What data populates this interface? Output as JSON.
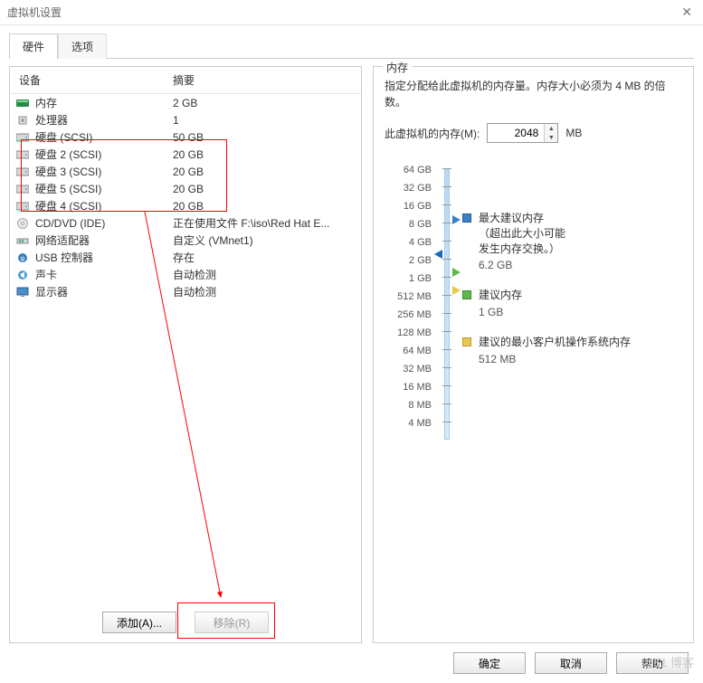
{
  "window_title": "虚拟机设置",
  "tabs": {
    "hardware": "硬件",
    "options": "选项"
  },
  "columns": {
    "device": "设备",
    "summary": "摘要"
  },
  "hardware": [
    {
      "icon": "memory-icon",
      "name": "内存",
      "summary": "2 GB"
    },
    {
      "icon": "cpu-icon",
      "name": "处理器",
      "summary": "1"
    },
    {
      "icon": "disk-icon",
      "name": "硬盘 (SCSI)",
      "summary": "50 GB"
    },
    {
      "icon": "disk-icon",
      "name": "硬盘 2 (SCSI)",
      "summary": "20 GB"
    },
    {
      "icon": "disk-icon",
      "name": "硬盘 3 (SCSI)",
      "summary": "20 GB"
    },
    {
      "icon": "disk-icon",
      "name": "硬盘 5 (SCSI)",
      "summary": "20 GB"
    },
    {
      "icon": "disk-icon",
      "name": "硬盘 4 (SCSI)",
      "summary": "20 GB"
    },
    {
      "icon": "cd-icon",
      "name": "CD/DVD (IDE)",
      "summary": "正在使用文件 F:\\iso\\Red Hat E..."
    },
    {
      "icon": "network-icon",
      "name": "网络适配器",
      "summary": "自定义 (VMnet1)"
    },
    {
      "icon": "usb-icon",
      "name": "USB 控制器",
      "summary": "存在"
    },
    {
      "icon": "sound-icon",
      "name": "声卡",
      "summary": "自动检测"
    },
    {
      "icon": "display-icon",
      "name": "显示器",
      "summary": "自动检测"
    }
  ],
  "buttons": {
    "add": "添加(A)...",
    "remove": "移除(R)",
    "ok": "确定",
    "cancel": "取消",
    "help": "帮助"
  },
  "memory_panel": {
    "title": "内存",
    "description": "指定分配给此虚拟机的内存量。内存大小必须为 4 MB 的倍数。",
    "label": "此虚拟机的内存(M):",
    "value": "2048",
    "unit": "MB",
    "ticks": [
      "64 GB",
      "32 GB",
      "16 GB",
      "8 GB",
      "4 GB",
      "2 GB",
      "1 GB",
      "512 MB",
      "256 MB",
      "128 MB",
      "64 MB",
      "32 MB",
      "16 MB",
      "8 MB",
      "4 MB"
    ],
    "legend": {
      "max": {
        "title": "最大建议内存",
        "note1": "（超出此大小可能",
        "note2": "发生内存交换。）",
        "value": "6.2 GB",
        "color": "#3a80c8"
      },
      "rec": {
        "title": "建议内存",
        "value": "1 GB",
        "color": "#5fb84b"
      },
      "min": {
        "title": "建议的最小客户机操作系统内存",
        "value": "512 MB",
        "color": "#e8c84e"
      }
    }
  },
  "watermark": "@51 博客"
}
